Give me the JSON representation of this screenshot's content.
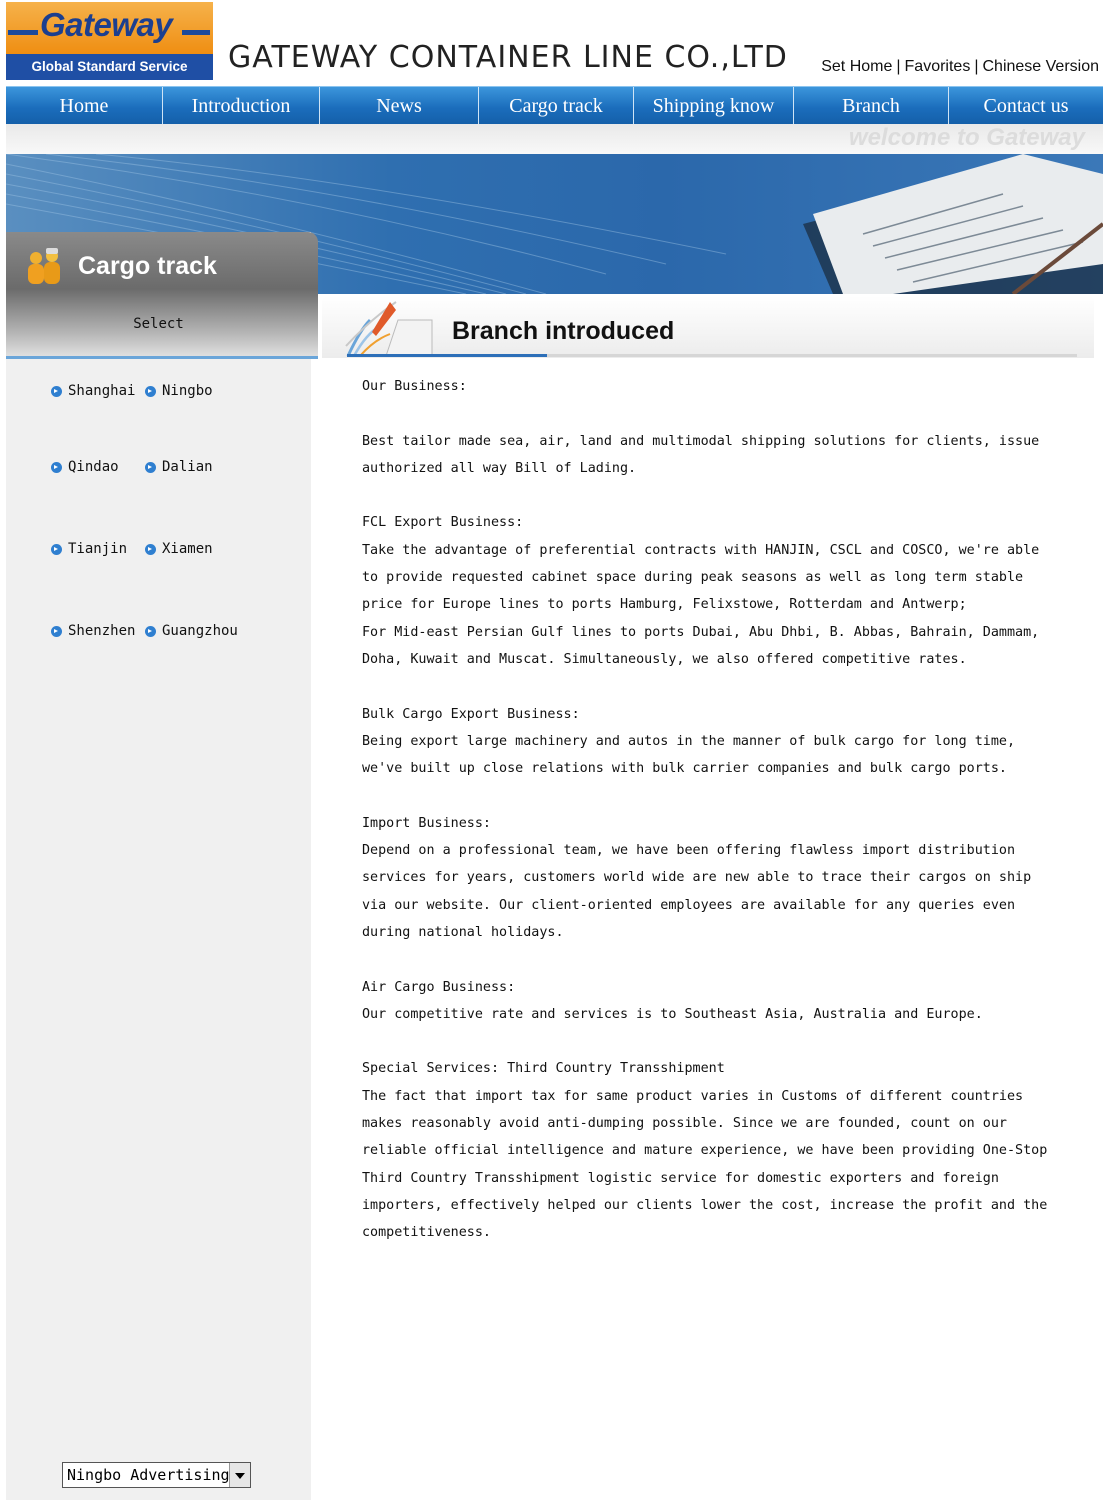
{
  "logo": {
    "name": "Gateway",
    "tagline": "Global Standard Service"
  },
  "header": {
    "company": "GATEWAY CONTAINER LINE CO.,LTD",
    "links": [
      "Set Home",
      "Favorites",
      "Chinese Version"
    ],
    "separator": "|"
  },
  "nav": {
    "items": [
      "Home",
      "Introduction",
      "News",
      "Cargo track",
      "Shipping know",
      "Branch",
      "Contact us"
    ],
    "welcome": "welcome to Gateway"
  },
  "sidebar": {
    "title": "Cargo track",
    "select_label": "Select",
    "cities": [
      "Shanghai",
      "Ningbo",
      "Qindao",
      "Dalian",
      "Tianjin",
      "Xiamen",
      "Shenzhen",
      "Guangzhou"
    ],
    "dropdown_value": "Ningbo Advertising"
  },
  "content": {
    "title": "Branch introduced",
    "lines": [
      "Our Business:",
      "",
      "Best tailor made sea, air, land and multimodal shipping solutions for clients, issue",
      "authorized all way Bill of Lading.",
      "",
      "FCL Export Business:",
      "Take the advantage of preferential contracts with HANJIN, CSCL and COSCO, we're able",
      "to provide requested cabinet space during peak seasons as well as long term stable",
      "price for Europe lines to ports Hamburg, Felixstowe, Rotterdam and Antwerp;",
      "For Mid-east Persian Gulf lines to ports Dubai, Abu Dhbi, B. Abbas, Bahrain, Dammam,",
      "Doha, Kuwait and Muscat. Simultaneously, we also offered competitive rates.",
      "",
      "Bulk Cargo Export Business:",
      "Being export large machinery and autos in the manner of bulk cargo for long time,",
      "we've built up close relations with bulk carrier companies and bulk cargo ports.",
      "",
      "Import Business:",
      "Depend on a professional team, we have been offering flawless import distribution",
      "services for years, customers world wide are new able to trace their cargos on ship",
      "via our website. Our client-oriented employees are available for any queries even",
      "during national holidays.",
      "",
      "Air Cargo Business:",
      "Our competitive rate and services is to Southeast Asia, Australia and Europe.",
      "",
      "Special Services: Third Country Transshipment",
      "The fact that import tax for same product varies in Customs of different countries",
      "makes reasonably avoid anti-dumping possible. Since we are founded, count on our",
      "reliable official intelligence and mature experience, we have been providing One-Stop",
      "Third Country Transshipment logistic service for domestic exporters and foreign",
      "importers, effectively helped our clients lower the cost, increase the profit and the",
      "competitiveness."
    ]
  },
  "colors": {
    "nav_blue": "#1b6dbc",
    "logo_orange": "#f39a1c",
    "logo_blue": "#1f4fa5",
    "bullet_blue": "#2f7fd0"
  }
}
